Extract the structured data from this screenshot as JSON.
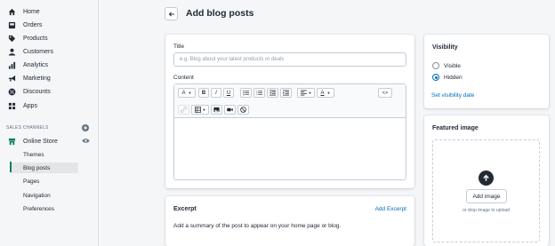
{
  "sidebar": {
    "items": [
      {
        "label": "Home",
        "icon": "home-icon"
      },
      {
        "label": "Orders",
        "icon": "orders-icon"
      },
      {
        "label": "Products",
        "icon": "tag-icon"
      },
      {
        "label": "Customers",
        "icon": "person-icon"
      },
      {
        "label": "Analytics",
        "icon": "bar-chart-icon"
      },
      {
        "label": "Marketing",
        "icon": "megaphone-icon"
      },
      {
        "label": "Discounts",
        "icon": "discount-icon"
      },
      {
        "label": "Apps",
        "icon": "apps-icon"
      }
    ],
    "sales_channels_label": "SALES CHANNELS",
    "online_store": {
      "label": "Online Store",
      "icon": "store-icon"
    },
    "sub_items": [
      "Themes",
      "Blog posts",
      "Pages",
      "Navigation",
      "Preferences"
    ],
    "active_sub_item": "Blog posts"
  },
  "header": {
    "title": "Add blog posts"
  },
  "post": {
    "title_label": "Title",
    "title_placeholder": "e.g. Blog about your latest products or deals",
    "content_label": "Content"
  },
  "excerpt": {
    "heading": "Excerpt",
    "add_link": "Add Excerpt",
    "description": "Add a summary of the post to appear on your home page or blog."
  },
  "visibility": {
    "heading": "Visibility",
    "options": [
      "Visible",
      "Hidden"
    ],
    "selected": "Hidden",
    "set_date_link": "Set visibility date"
  },
  "featured_image": {
    "heading": "Featured image",
    "button_label": "Add image",
    "hint": "or drop image to upload"
  },
  "colors": {
    "accent_green": "#008060",
    "link_blue": "#006fbb"
  }
}
